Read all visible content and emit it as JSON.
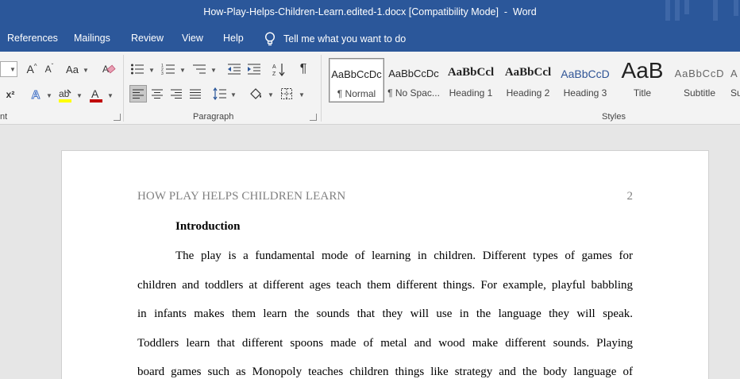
{
  "titlebar": {
    "title": "How-Play-Helps-Children-Learn.edited-1.docx [Compatibility Mode]  -  Word"
  },
  "tabs": [
    {
      "label": "References"
    },
    {
      "label": "Mailings"
    },
    {
      "label": "Review"
    },
    {
      "label": "View"
    },
    {
      "label": "Help"
    }
  ],
  "tell_me": {
    "label": "Tell me what you want to do",
    "icon": "lightbulb-icon"
  },
  "ribbon": {
    "font_group_label": "nt",
    "paragraph_group_label": "Paragraph",
    "styles_group_label": "Styles",
    "font_icons": {
      "grow": "A",
      "shrink": "A",
      "change_case": "Aa",
      "superscript": "x²",
      "text_effects": "A",
      "font_color": "A"
    },
    "styles": [
      {
        "sample": "AaBbCcDc",
        "name": "¶ Normal",
        "selected": true
      },
      {
        "sample": "AaBbCcDc",
        "name": "¶ No Spac..."
      },
      {
        "sample": "AaBbCcl",
        "name": "Heading 1"
      },
      {
        "sample": "AaBbCcl",
        "name": "Heading 2"
      },
      {
        "sample": "AaBbCcD",
        "name": "Heading 3"
      },
      {
        "sample": "AaB",
        "name": "Title"
      },
      {
        "sample": "AaBbCcD",
        "name": "Subtitle"
      },
      {
        "sample": "A",
        "name": "Su"
      }
    ]
  },
  "document": {
    "header": "HOW PLAY HELPS CHILDREN LEARN",
    "page_number": "2",
    "heading": "Introduction",
    "lines": [
      "The play is a fundamental mode of learning in children. Different types of games for",
      "children and toddlers at different ages teach them different things. For example, playful babbling",
      "in infants makes them learn the sounds that they will use in the language they will speak.",
      "Toddlers learn that different spoons made of metal and wood make different sounds. Playing",
      "board games such as Monopoly teaches children things like strategy and the body language of"
    ]
  },
  "colors": {
    "word_blue": "#2b579a",
    "ribbon_bg": "#f3f3f3",
    "canvas_bg": "#e6e6e6",
    "header_gray": "#808080",
    "highlight_yellow": "#ffff00",
    "font_red": "#c00000",
    "heading_blue": "#2f5496"
  }
}
